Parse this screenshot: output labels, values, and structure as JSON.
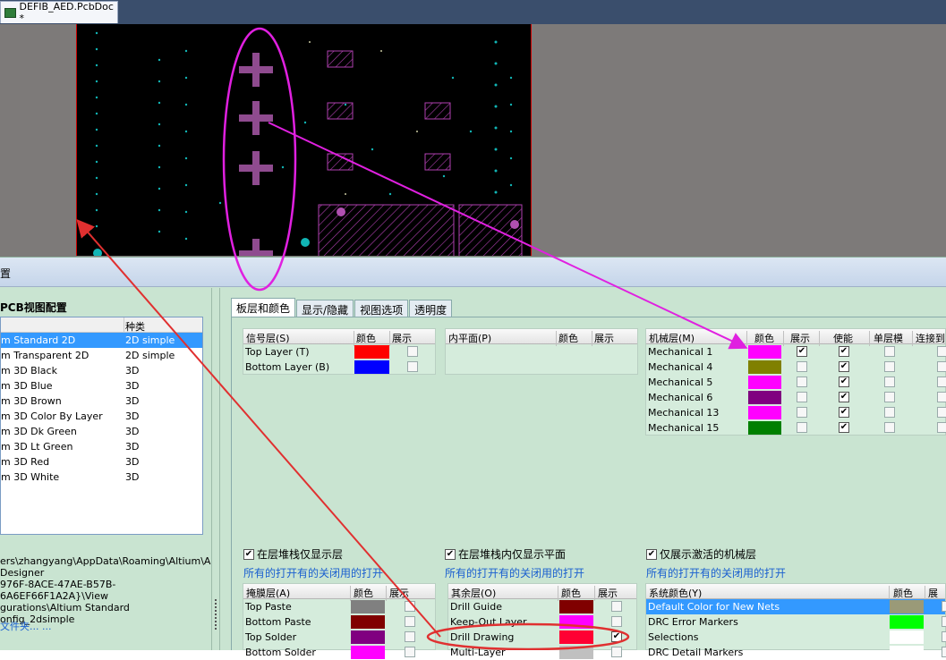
{
  "tab": {
    "title": "DEFIB_AED.PcbDoc *"
  },
  "dialog": {
    "title": "置"
  },
  "left": {
    "heading": "PCB视图配置",
    "col_name": "",
    "col_type": "种类",
    "rows": [
      {
        "name": "m Standard 2D",
        "type": "2D simple"
      },
      {
        "name": "m Transparent 2D",
        "type": "2D simple"
      },
      {
        "name": "m 3D Black",
        "type": "3D"
      },
      {
        "name": "m 3D Blue",
        "type": "3D"
      },
      {
        "name": "m 3D Brown",
        "type": "3D"
      },
      {
        "name": "m 3D Color By Layer",
        "type": "3D"
      },
      {
        "name": "m 3D Dk Green",
        "type": "3D"
      },
      {
        "name": "m 3D Lt Green",
        "type": "3D"
      },
      {
        "name": "m 3D Red",
        "type": "3D"
      },
      {
        "name": "m 3D White",
        "type": "3D"
      }
    ],
    "path_lines": [
      "ers\\zhangyang\\AppData\\Roaming\\Altium\\A",
      " Designer",
      "976F-8ACE-47AE-B57B-6A6EF66F1A2A}\\View",
      "gurations\\Altium Standard",
      "onfig_2dsimple"
    ],
    "folder_link": "文件夹... ..."
  },
  "tabs": [
    "板层和颜色",
    "显示/隐藏",
    "视图选项",
    "透明度"
  ],
  "signal": {
    "h_name": "信号层(S)",
    "h_color": "颜色",
    "h_show": "展示",
    "rows": [
      {
        "name": "Top Layer (T)",
        "color": "#ff0000"
      },
      {
        "name": "Bottom Layer (B)",
        "color": "#0000ff"
      }
    ]
  },
  "internal": {
    "h_name": "内平面(P)",
    "h_color": "颜色",
    "h_show": "展示"
  },
  "mech": {
    "h_name": "机械层(M)",
    "h_color": "颜色",
    "h_show": "展示",
    "h_enable": "使能",
    "h_single": "单层模",
    "h_link": "连接到",
    "rows": [
      {
        "name": "Mechanical 1",
        "color": "#ff00ff"
      },
      {
        "name": "Mechanical 4",
        "color": "#808000"
      },
      {
        "name": "Mechanical 5",
        "color": "#ff00ff"
      },
      {
        "name": "Mechanical 6",
        "color": "#800080"
      },
      {
        "name": "Mechanical 13",
        "color": "#ff00ff"
      },
      {
        "name": "Mechanical 15",
        "color": "#008000"
      }
    ]
  },
  "options": {
    "only_stack": "在层堆栈仅显示层",
    "only_planes": "在层堆栈内仅显示平面",
    "only_mech": "仅展示激活的机械层",
    "links": "所有的打开有的关闭用的打开"
  },
  "mask": {
    "h_name": "掩膜层(A)",
    "h_color": "颜色",
    "h_show": "展示",
    "rows": [
      {
        "name": "Top Paste",
        "color": "#808080"
      },
      {
        "name": "Bottom Paste",
        "color": "#800000"
      },
      {
        "name": "Top Solder",
        "color": "#800080"
      },
      {
        "name": "Bottom Solder",
        "color": "#ff00ff"
      }
    ]
  },
  "other": {
    "h_name": "其余层(O)",
    "h_color": "颜色",
    "h_show": "展示",
    "rows": [
      {
        "name": "Drill Guide",
        "color": "#800000"
      },
      {
        "name": "Keep-Out Layer",
        "color": "#ff00ff"
      },
      {
        "name": "Drill Drawing",
        "color": "#ff0033"
      },
      {
        "name": "Multi-Layer",
        "color": "#c0c0c0"
      }
    ]
  },
  "system": {
    "h_name": "系统颜色(Y)",
    "h_color": "颜色",
    "h_show": "展示",
    "rows": [
      {
        "name": "Default Color for New Nets",
        "color": "#9a9a78"
      },
      {
        "name": "DRC Error Markers",
        "color": "#00ff00"
      },
      {
        "name": "Selections",
        "color": "#ffffff"
      },
      {
        "name": "DRC Detail Markers",
        "color": "#ffffff"
      }
    ]
  }
}
